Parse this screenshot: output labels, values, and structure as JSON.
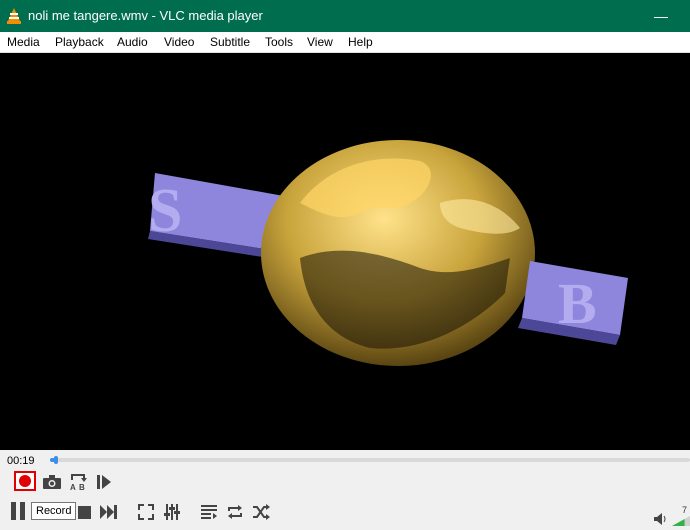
{
  "window": {
    "title": "noli me tangere.wmv - VLC media player",
    "minimize_glyph": "—"
  },
  "menu": [
    "Media",
    "Playback",
    "Audio",
    "Video",
    "Subtitle",
    "Tools",
    "View",
    "Help"
  ],
  "player": {
    "elapsed_time": "00:19",
    "seek_fraction": 0.01,
    "tooltip": "Record",
    "volume_label": "7",
    "volume_fraction": 0.7
  },
  "video_frame": {
    "left_letter": "S",
    "right_letter": "B"
  },
  "colors": {
    "titlebar": "#006d4f",
    "record_highlight": "#e00000",
    "seek": "#3c8ee8",
    "globe": "#c9a43c",
    "letters": "#8e86dd"
  },
  "icons": {
    "row1": [
      "record-icon",
      "snapshot-icon",
      "ab-loop-icon",
      "frame-by-frame-icon"
    ],
    "row2": [
      "pause-icon",
      "stop-icon",
      "next-icon",
      "fullscreen-icon",
      "extended-settings-icon",
      "playlist-icon",
      "loop-icon",
      "shuffle-icon",
      "speaker-icon"
    ]
  }
}
